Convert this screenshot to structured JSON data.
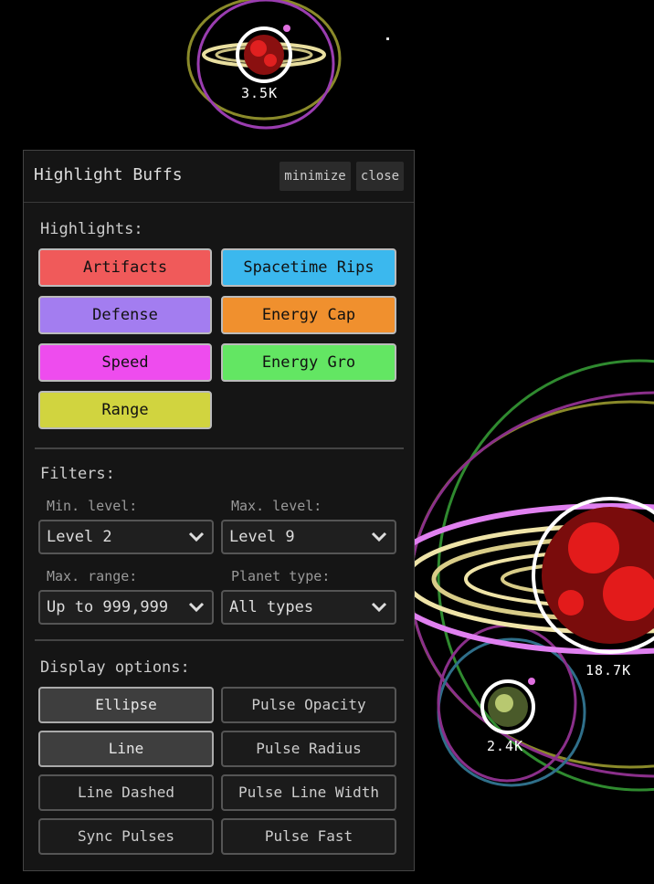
{
  "planets": [
    {
      "label": "3.5K"
    },
    {
      "label": "18.7K"
    },
    {
      "label": "2.4K"
    }
  ],
  "panel": {
    "title": "Highlight Buffs",
    "minimize_label": "minimize",
    "close_label": "close"
  },
  "highlights": {
    "label": "Highlights:",
    "buttons": [
      {
        "label": "Artifacts",
        "color": "#f05a5a"
      },
      {
        "label": "Spacetime Rips",
        "color": "#3bb8ee"
      },
      {
        "label": "Defense",
        "color": "#a37df0"
      },
      {
        "label": "Energy Cap",
        "color": "#f0902e"
      },
      {
        "label": "Speed",
        "color": "#ee4cee"
      },
      {
        "label": "Energy Gro",
        "color": "#63e663"
      },
      {
        "label": "Range",
        "color": "#d1d43f"
      }
    ]
  },
  "filters": {
    "label": "Filters:",
    "min_level_label": "Min. level:",
    "min_level_value": "Level 2",
    "max_level_label": "Max. level:",
    "max_level_value": "Level 9",
    "max_range_label": "Max. range:",
    "max_range_value": "Up to 999,999",
    "planet_type_label": "Planet type:",
    "planet_type_value": "All types"
  },
  "display": {
    "label": "Display options:",
    "options": [
      {
        "label": "Ellipse",
        "selected": true
      },
      {
        "label": "Pulse Opacity",
        "selected": false
      },
      {
        "label": "Line",
        "selected": true
      },
      {
        "label": "Pulse Radius",
        "selected": false
      },
      {
        "label": "Line Dashed",
        "selected": false
      },
      {
        "label": "Pulse Line Width",
        "selected": false
      },
      {
        "label": "Sync Pulses",
        "selected": false
      },
      {
        "label": "Pulse Fast",
        "selected": false
      }
    ]
  }
}
